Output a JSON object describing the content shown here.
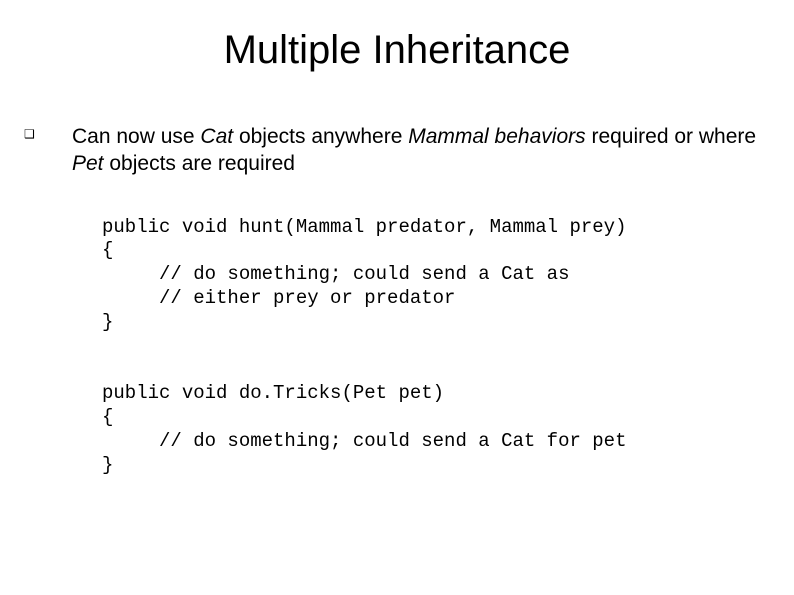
{
  "title": "Multiple Inheritance",
  "bullet": {
    "pre_cat": "Can now use ",
    "cat": "Cat",
    "post_cat": " objects anywhere ",
    "mammal": "Mammal behaviors",
    "post_mammal": " required or where ",
    "pet": "Pet",
    "post_pet": " objects are required"
  },
  "code1": {
    "l1": "public void hunt(Mammal predator, Mammal prey)",
    "l2": "{",
    "l3": "     // do something; could send a Cat as",
    "l4": "     // either prey or predator",
    "l5": "}"
  },
  "code2": {
    "l1": "public void do.Tricks(Pet pet)",
    "l2": "{",
    "l3": "     // do something; could send a Cat for pet",
    "l4": "}"
  }
}
